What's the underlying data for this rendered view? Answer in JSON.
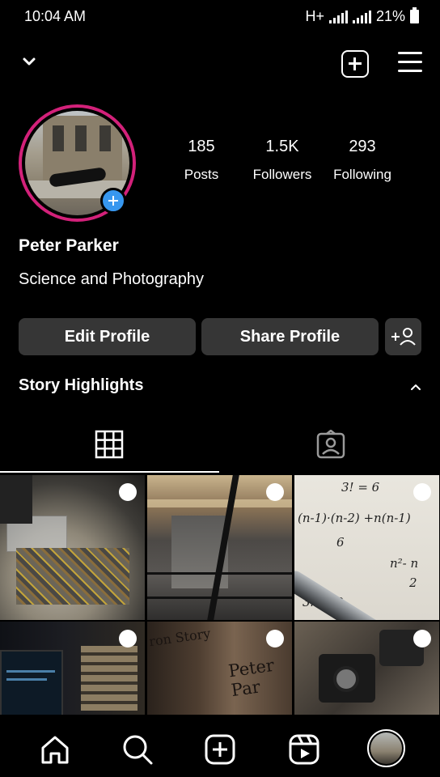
{
  "status_bar": {
    "time": "10:04 AM",
    "network": "H+",
    "battery": "21%"
  },
  "profile": {
    "name": "Peter Parker",
    "bio": "Science and Photography",
    "ring_color": "#d3217a"
  },
  "stats": [
    {
      "value": "185",
      "label": "Posts"
    },
    {
      "value": "1.5K",
      "label": "Followers"
    },
    {
      "value": "293",
      "label": "Following"
    }
  ],
  "buttons": {
    "edit_profile": "Edit Profile",
    "share_profile": "Share Profile"
  },
  "highlights": {
    "label": "Story Highlights"
  },
  "tabs": [
    {
      "icon": "grid-icon",
      "selected": true
    },
    {
      "icon": "tagged-icon",
      "selected": false
    }
  ],
  "grid": {
    "posts": [
      {
        "icon": "lego-photo"
      },
      {
        "icon": "city-street-photo"
      },
      {
        "icon": "math-notes-photo"
      },
      {
        "icon": "laptop-books-photo"
      },
      {
        "icon": "peter-parker-box-photo"
      },
      {
        "icon": "cameras-photo"
      }
    ],
    "cell_texts": {
      "math_lines": [
        "3! = 6",
        "(n-1)·(n-2) +n(n-1)",
        "6",
        "n²- n",
        "2",
        "3n + 2"
      ],
      "box_title": "Peter Par",
      "box_sub": "ron Story"
    }
  },
  "bottom_nav": [
    {
      "icon": "home-icon"
    },
    {
      "icon": "search-icon"
    },
    {
      "icon": "add-post-icon"
    },
    {
      "icon": "reels-icon"
    },
    {
      "icon": "profile-avatar"
    }
  ],
  "colors": {
    "background": "#000000",
    "button": "#363636",
    "accent_blue": "#3797ef"
  }
}
